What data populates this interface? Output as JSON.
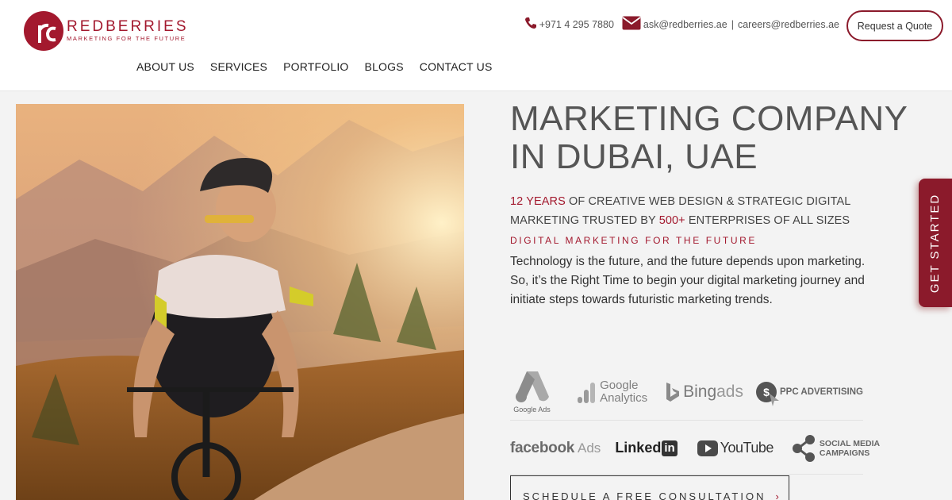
{
  "brand": {
    "name": "REDBERRIES",
    "tagline": "MARKETING FOR THE FUTURE"
  },
  "nav": [
    {
      "label": "ABOUT US"
    },
    {
      "label": "SERVICES"
    },
    {
      "label": "PORTFOLIO"
    },
    {
      "label": "BLOGS"
    },
    {
      "label": "CONTACT US"
    }
  ],
  "contact": {
    "phone": "+971 4 295 7880",
    "email": "ask@redberries.ae",
    "separator": "|",
    "careers": "careers@redberries.ae",
    "quote_label": "Request a Quote"
  },
  "hero": {
    "headline": "MARKETING COMPANY IN DUBAI, UAE",
    "years_highlight": "12 YEARS",
    "years_text": " OF CREATIVE WEB DESIGN & STRATEGIC DIGITAL MARKETING TRUSTED BY ",
    "enterprises_highlight": "500+",
    "enterprises_text": " ENTERPRISES OF ALL SIZES",
    "kicker": "DIGITAL MARKETING FOR THE FUTURE",
    "description": "Technology is the future, and the future depends upon marketing. So, it’s the Right Time to begin your digital marketing journey and initiate steps towards futuristic marketing trends.",
    "cta_label": "SCHEDULE A FREE CONSULTATION",
    "cta_arrow": "›"
  },
  "partners_row1": {
    "google_ads": "Google Ads",
    "google_analytics_1": "Google",
    "google_analytics_2": "Analytics",
    "bing_1": "Bing",
    "bing_2": " ads",
    "ppc": "PPC ADVERTISING",
    "dollar": "$"
  },
  "partners_row2": {
    "facebook": "facebook",
    "facebook_ads": "Ads",
    "linked": "Linked",
    "in": "in",
    "youtube": "YouTube",
    "social_1": "SOCIAL MEDIA",
    "social_2": "CAMPAIGNS"
  },
  "side_tab": "GET STARTED",
  "colors": {
    "brand_red": "#a3192e",
    "dark_red": "#8b1a2b",
    "text_gray": "#555555"
  }
}
